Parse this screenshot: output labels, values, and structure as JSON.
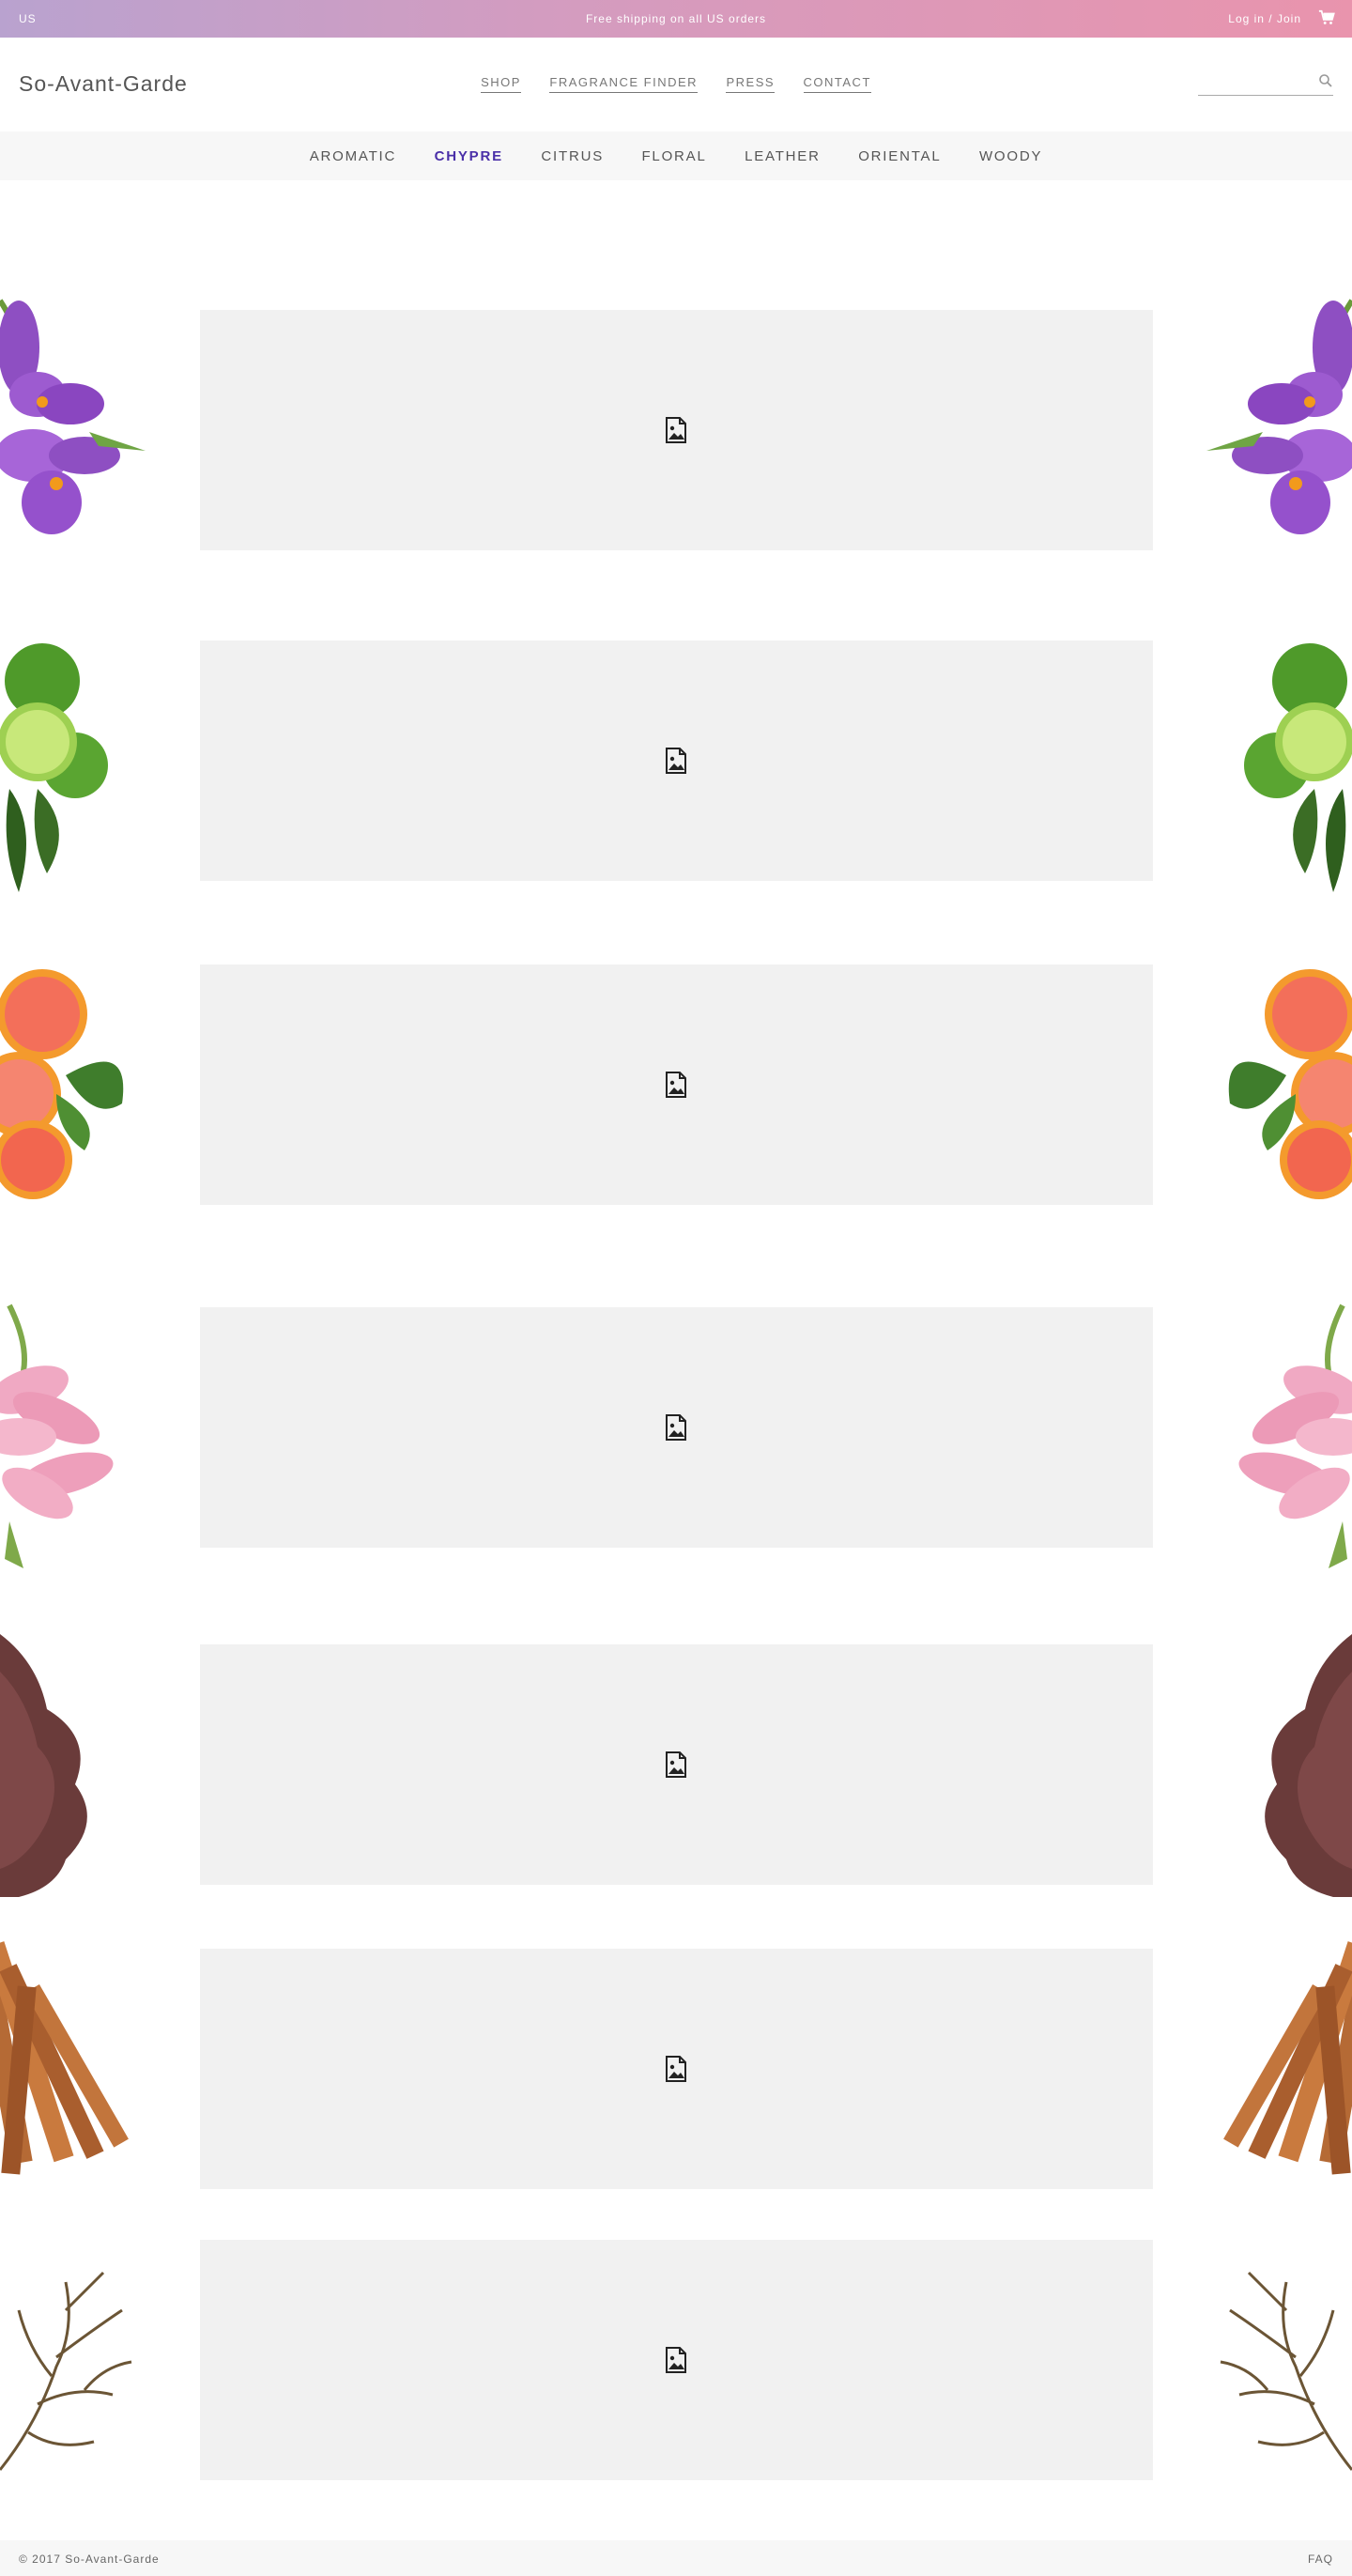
{
  "topbar": {
    "region": "US",
    "shipping": "Free shipping on all US orders",
    "login": "Log in / Join",
    "cart_icon": "cart-icon"
  },
  "header": {
    "logo": "So-Avant-Garde",
    "nav": [
      "SHOP",
      "FRAGRANCE FINDER",
      "PRESS",
      "CONTACT"
    ],
    "search_placeholder": "",
    "search_icon": "search-icon"
  },
  "categories": {
    "items": [
      "AROMATIC",
      "CHYPRE",
      "CITRUS",
      "FLORAL",
      "LEATHER",
      "ORIENTAL",
      "WOODY"
    ],
    "active": "CHYPRE"
  },
  "rows": [
    {
      "decoration": "crocus-flower-image",
      "placeholder_icon": "broken-image-icon"
    },
    {
      "decoration": "lime-image",
      "placeholder_icon": "broken-image-icon"
    },
    {
      "decoration": "grapefruit-image",
      "placeholder_icon": "broken-image-icon"
    },
    {
      "decoration": "pink-lily-image",
      "placeholder_icon": "broken-image-icon"
    },
    {
      "decoration": "leather-image",
      "placeholder_icon": "broken-image-icon"
    },
    {
      "decoration": "cinnamon-sticks-image",
      "placeholder_icon": "broken-image-icon"
    },
    {
      "decoration": "dry-branch-image",
      "placeholder_icon": "broken-image-icon"
    }
  ],
  "footer": {
    "copyright": "© 2017 So-Avant-Garde",
    "faq": "FAQ"
  },
  "colors": {
    "banner_start": "#b9a2cf",
    "banner_end": "#e994ad",
    "active_category": "#4a2fa8",
    "panel_bg": "#f1f1f1"
  }
}
